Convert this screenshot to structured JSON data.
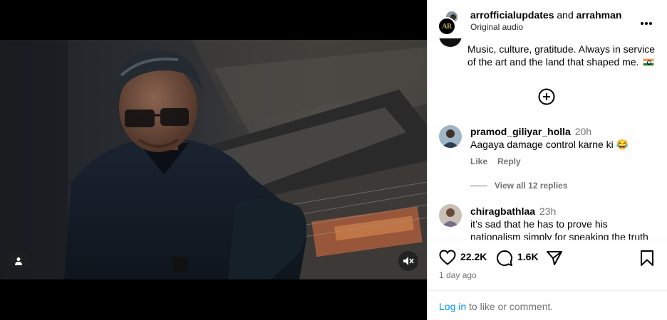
{
  "post": {
    "authors": [
      "arrofficialupdates",
      "arrahman"
    ],
    "author_separator": "and",
    "audio": "Original audio",
    "avatar_monogram": "AR"
  },
  "caption": {
    "text": "Music, culture, gratitude. Always in service of the art and the land that shaped me."
  },
  "comments": [
    {
      "username": "pramod_giliyar_holla",
      "time": "20h",
      "text": "Aagaya damage control karne ki 😂",
      "like_label": "Like",
      "reply_label": "Reply",
      "view_replies": "View all 12 replies"
    },
    {
      "username": "chiragbathlaa",
      "time": "23h",
      "text": "it’s sad that he has to prove his nationalism simply for speaking the truth"
    }
  ],
  "engagement": {
    "likes": "22.2K",
    "comments": "1.6K",
    "posted": "1 day ago"
  },
  "login": {
    "link": "Log in",
    "rest": "to like or comment."
  },
  "icons": {
    "more": "more-options-icon",
    "add": "load-more-comments-icon",
    "like": "heart-icon",
    "comment": "comment-bubble-icon",
    "share": "paper-plane-icon",
    "save": "bookmark-icon",
    "tags": "user-tag-icon",
    "mute": "muted-speaker-icon"
  }
}
